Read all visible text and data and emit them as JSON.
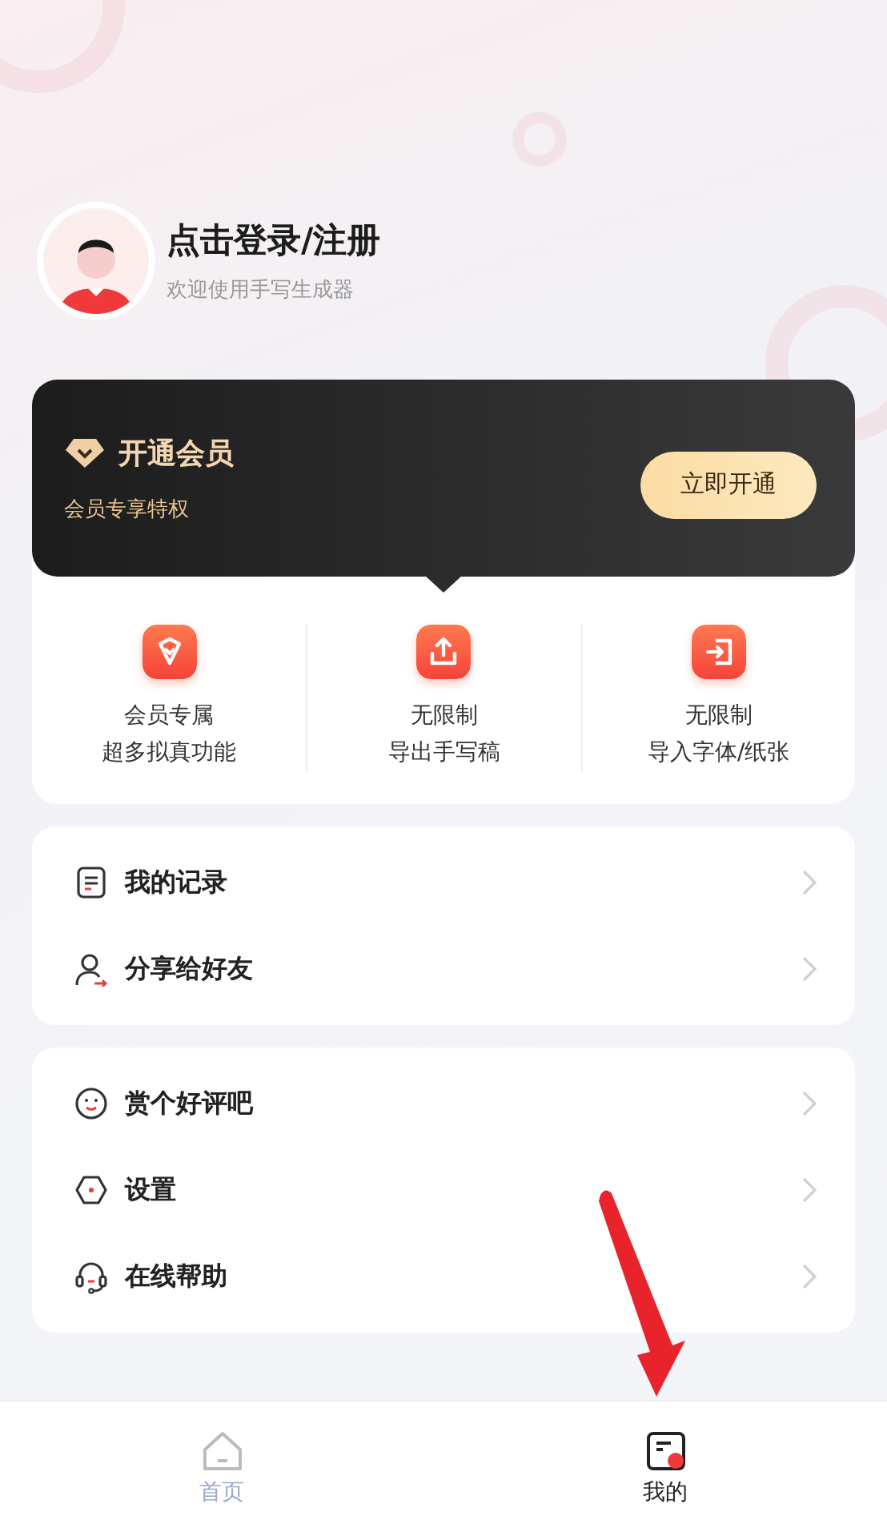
{
  "profile": {
    "title": "点击登录/注册",
    "subtitle": "欢迎使用手写生成器"
  },
  "membership": {
    "title": "开通会员",
    "subtitle": "会员专享特权",
    "button": "立即开通"
  },
  "benefits": [
    {
      "line1": "会员专属",
      "line2": "超多拟真功能"
    },
    {
      "line1": "无限制",
      "line2": "导出手写稿"
    },
    {
      "line1": "无限制",
      "line2": "导入字体/纸张"
    }
  ],
  "menu_groups": [
    [
      {
        "label": "我的记录"
      },
      {
        "label": "分享给好友"
      }
    ],
    [
      {
        "label": "赏个好评吧"
      },
      {
        "label": "设置"
      },
      {
        "label": "在线帮助"
      }
    ]
  ],
  "tab_bar": [
    {
      "label": "首页",
      "selected": false
    },
    {
      "label": "我的",
      "selected": true
    }
  ]
}
